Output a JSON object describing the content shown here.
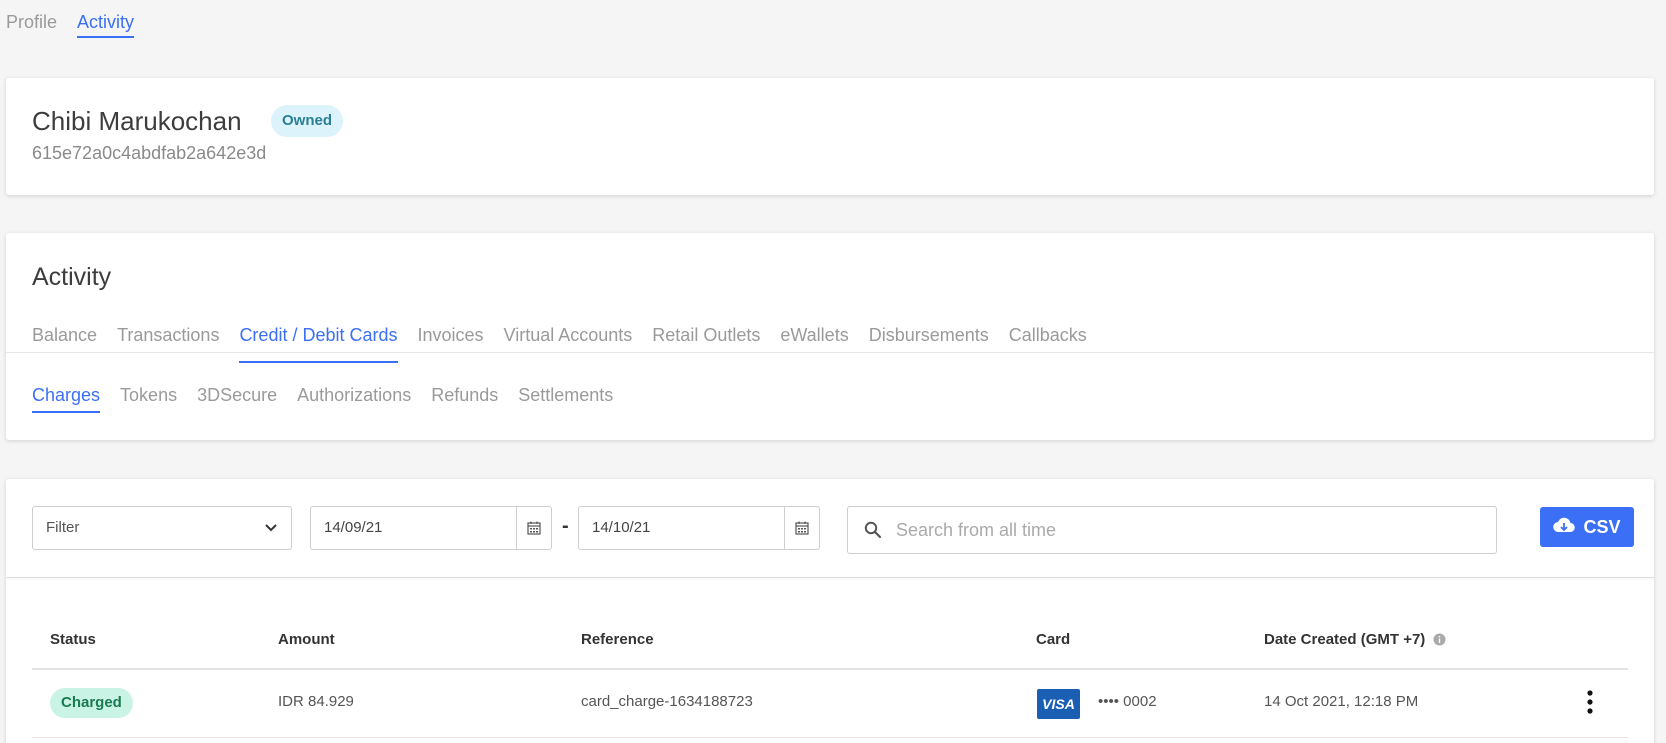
{
  "top_tabs": [
    {
      "label": "Profile",
      "active": false
    },
    {
      "label": "Activity",
      "active": true
    }
  ],
  "profile": {
    "name": "Chibi Marukochan",
    "badge": "Owned",
    "id": "615e72a0c4abdfab2a642e3d"
  },
  "activity": {
    "title": "Activity",
    "tabs": [
      {
        "label": "Balance",
        "active": false
      },
      {
        "label": "Transactions",
        "active": false
      },
      {
        "label": "Credit / Debit Cards",
        "active": true
      },
      {
        "label": "Invoices",
        "active": false
      },
      {
        "label": "Virtual Accounts",
        "active": false
      },
      {
        "label": "Retail Outlets",
        "active": false
      },
      {
        "label": "eWallets",
        "active": false
      },
      {
        "label": "Disbursements",
        "active": false
      },
      {
        "label": "Callbacks",
        "active": false
      }
    ],
    "subtabs": [
      {
        "label": "Charges",
        "active": true
      },
      {
        "label": "Tokens",
        "active": false
      },
      {
        "label": "3DSecure",
        "active": false
      },
      {
        "label": "Authorizations",
        "active": false
      },
      {
        "label": "Refunds",
        "active": false
      },
      {
        "label": "Settlements",
        "active": false
      }
    ]
  },
  "toolbar": {
    "filter_label": "Filter",
    "date_from": "14/09/21",
    "date_separator": "-",
    "date_to": "14/10/21",
    "search_placeholder": "Search from all time",
    "csv_label": "CSV"
  },
  "table": {
    "headers": {
      "status": "Status",
      "amount": "Amount",
      "reference": "Reference",
      "card": "Card",
      "date_created": "Date Created (GMT +7)"
    },
    "rows": [
      {
        "status": "Charged",
        "amount": "IDR 84.929",
        "reference": "card_charge-1634188723",
        "card_brand": "VISA",
        "card_number": "•••• 0002",
        "date_created": "14 Oct 2021, 12:18 PM"
      }
    ]
  },
  "colors": {
    "accent": "#3b6ff5",
    "status_charged_bg": "#c9f3e4",
    "status_charged_text": "#1a7a52",
    "owned_badge_bg": "#dcf3fb",
    "visa_blue": "#1a5fb4"
  },
  "icons": {
    "filter_dropdown": "chevron-down-icon",
    "date_picker": "calendar-icon",
    "search": "search-icon",
    "csv": "cloud-download-icon",
    "date_info": "info-icon",
    "row_actions": "more-vertical-icon"
  }
}
